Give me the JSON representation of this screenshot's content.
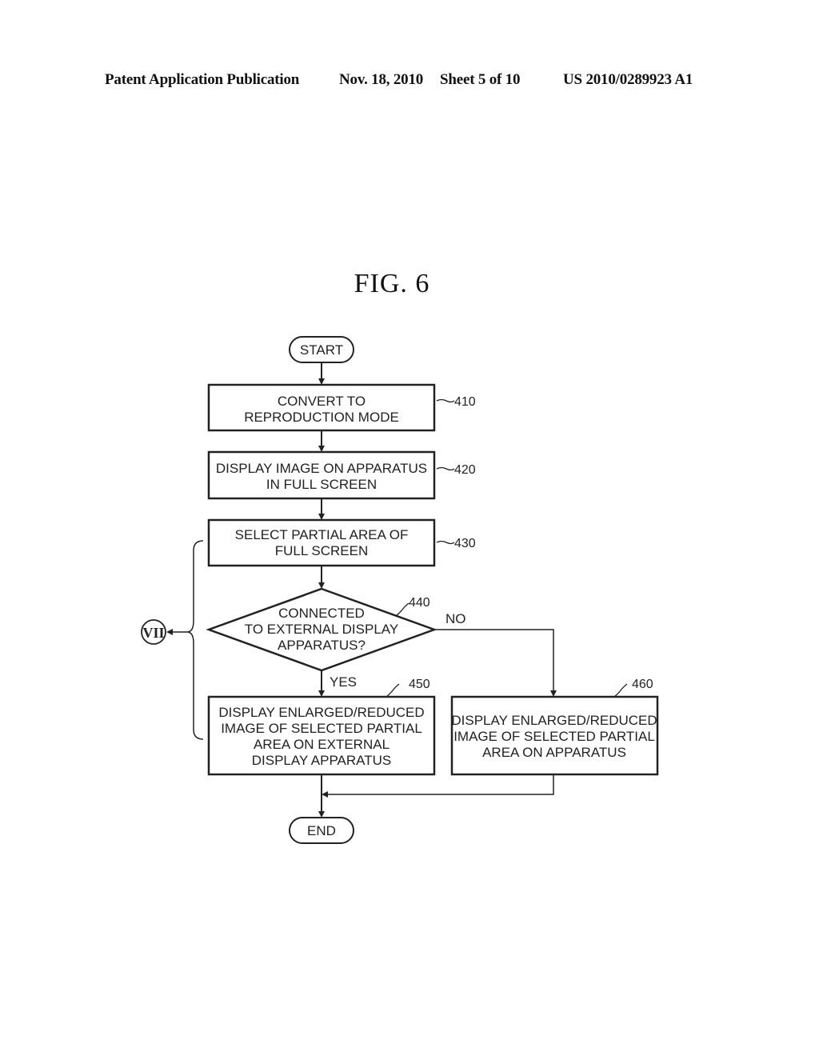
{
  "header": {
    "publication": "Patent Application Publication",
    "date": "Nov. 18, 2010",
    "sheet": "Sheet 5 of 10",
    "number": "US 2010/0289923 A1"
  },
  "figure": {
    "title": "FIG.  6",
    "start": "START",
    "end": "END",
    "steps": [
      {
        "ref": "410",
        "lines": [
          "CONVERT TO",
          "REPRODUCTION MODE"
        ]
      },
      {
        "ref": "420",
        "lines": [
          "DISPLAY IMAGE ON APPARATUS",
          "IN FULL SCREEN"
        ]
      },
      {
        "ref": "430",
        "lines": [
          "SELECT PARTIAL AREA OF",
          "FULL SCREEN"
        ]
      }
    ],
    "decision": {
      "ref": "440",
      "lines": [
        "CONNECTED",
        "TO EXTERNAL DISPLAY",
        "APPARATUS?"
      ],
      "yes": "YES",
      "no": "NO"
    },
    "yes_step": {
      "ref": "450",
      "lines": [
        "DISPLAY ENLARGED/REDUCED",
        "IMAGE OF SELECTED PARTIAL",
        "AREA ON EXTERNAL",
        "DISPLAY APPARATUS"
      ]
    },
    "no_step": {
      "ref": "460",
      "lines": [
        "DISPLAY ENLARGED/REDUCED",
        "IMAGE OF SELECTED PARTIAL",
        "AREA ON APPARATUS"
      ]
    },
    "bracket_label": "VII"
  }
}
